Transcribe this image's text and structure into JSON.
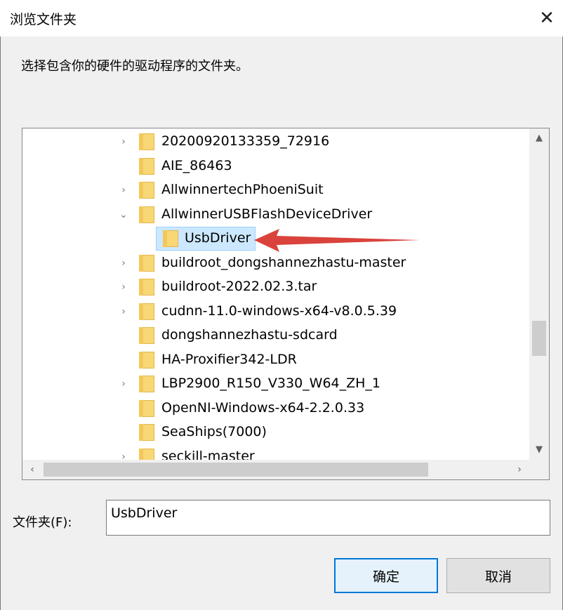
{
  "window": {
    "title": "浏览文件夹",
    "close_glyph": "✕"
  },
  "instruction": "选择包含你的硬件的驱动程序的文件夹。",
  "tree": {
    "items": [
      {
        "label": "20200920133359_72916",
        "expandable": true
      },
      {
        "label": "AIE_86463",
        "expandable": false
      },
      {
        "label": "AllwinnertechPhoeniSuit",
        "expandable": true
      },
      {
        "label": "AllwinnerUSBFlashDeviceDriver",
        "expandable": true,
        "expanded": true
      },
      {
        "label": "UsbDriver",
        "expandable": false,
        "selected": true
      },
      {
        "label": "buildroot_dongshannezhastu-master",
        "expandable": true
      },
      {
        "label": "buildroot-2022.02.3.tar",
        "expandable": true
      },
      {
        "label": "cudnn-11.0-windows-x64-v8.0.5.39",
        "expandable": true
      },
      {
        "label": "dongshannezhastu-sdcard",
        "expandable": false
      },
      {
        "label": "HA-Proxifier342-LDR",
        "expandable": false
      },
      {
        "label": "LBP2900_R150_V330_W64_ZH_1",
        "expandable": true
      },
      {
        "label": "OpenNI-Windows-x64-2.2.0.33",
        "expandable": false
      },
      {
        "label": "SeaShips(7000)",
        "expandable": false
      },
      {
        "label": "seckill-master",
        "expandable": true
      }
    ]
  },
  "folder_field": {
    "label": "文件夹(F):",
    "value": "UsbDriver"
  },
  "buttons": {
    "ok": "确定",
    "cancel": "取消"
  },
  "colors": {
    "selection_bg": "#cce8ff",
    "annotation_arrow": "#d9433b",
    "folder": "#f8d775"
  }
}
